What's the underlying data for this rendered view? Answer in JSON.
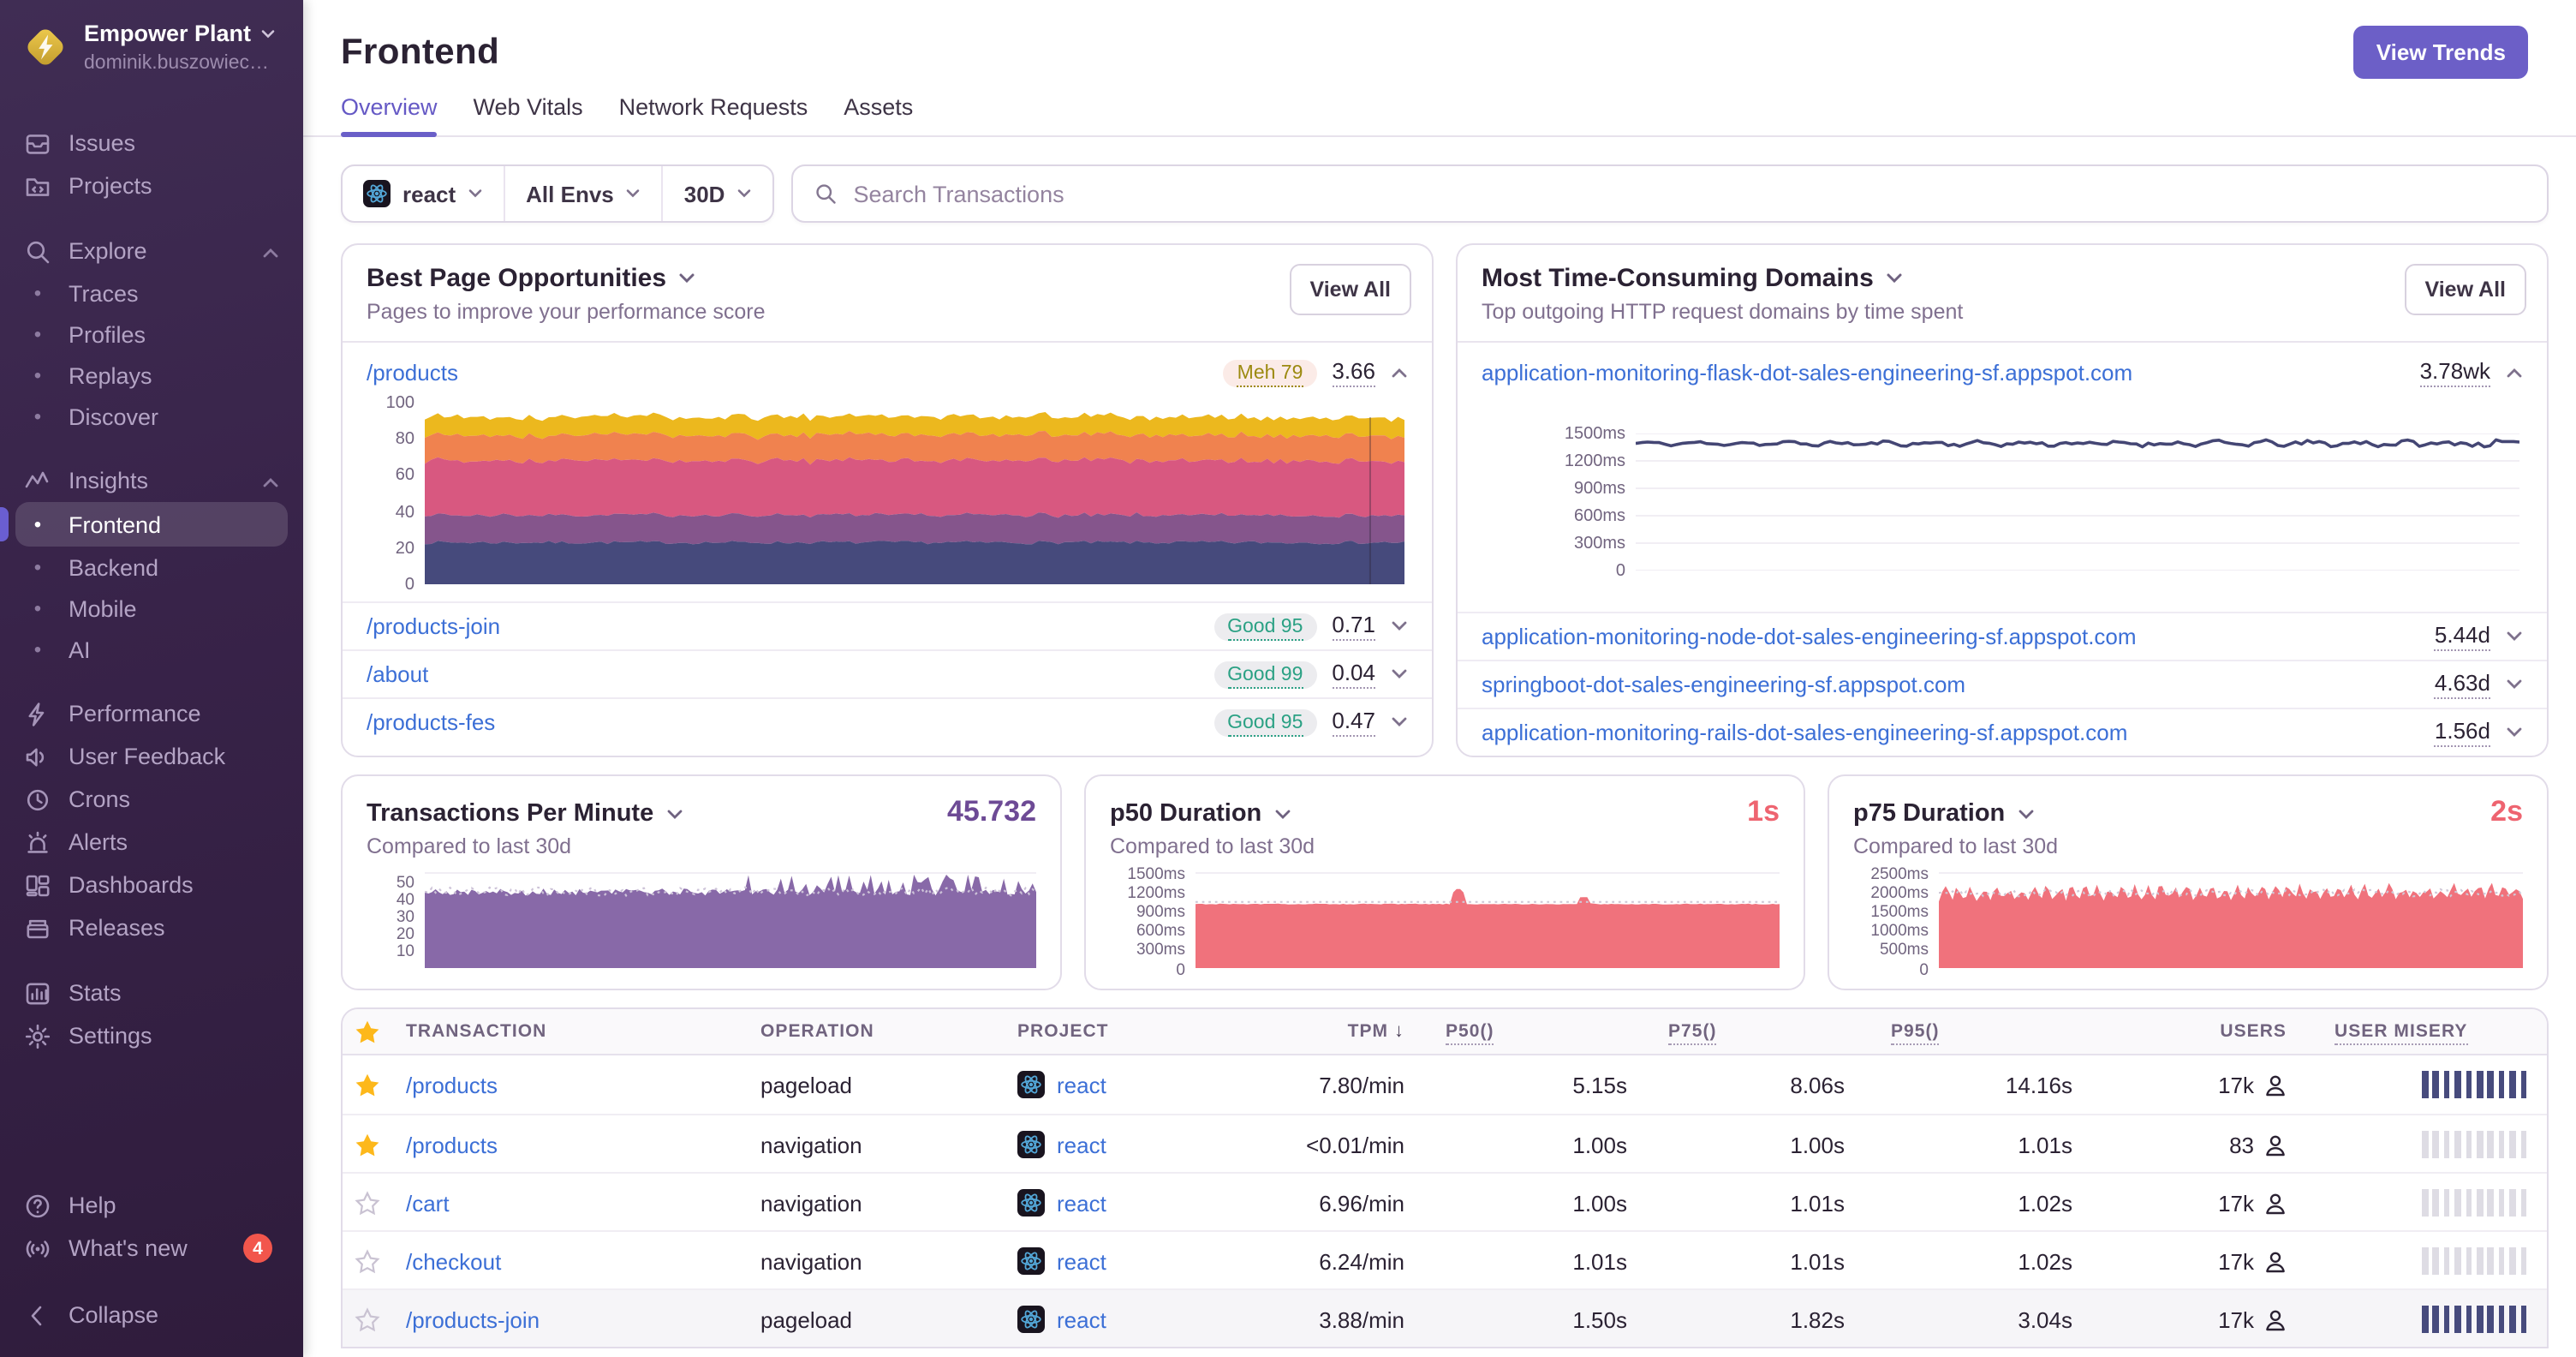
{
  "org": {
    "name": "Empower Plant",
    "subtitle": "dominik.buszowiec…"
  },
  "sidebar": {
    "groups": [
      {
        "items": [
          {
            "icon": "issues",
            "label": "Issues"
          },
          {
            "icon": "projects",
            "label": "Projects"
          }
        ]
      },
      {
        "header": {
          "icon": "search",
          "label": "Explore"
        },
        "items": [
          {
            "bullet": true,
            "label": "Traces"
          },
          {
            "bullet": true,
            "label": "Profiles"
          },
          {
            "bullet": true,
            "label": "Replays"
          },
          {
            "bullet": true,
            "label": "Discover"
          }
        ]
      },
      {
        "header": {
          "icon": "insights",
          "label": "Insights"
        },
        "items": [
          {
            "bullet": true,
            "label": "Frontend",
            "selected": true
          },
          {
            "bullet": true,
            "label": "Backend"
          },
          {
            "bullet": true,
            "label": "Mobile"
          },
          {
            "bullet": true,
            "label": "AI"
          }
        ]
      },
      {
        "items": [
          {
            "icon": "performance",
            "label": "Performance"
          },
          {
            "icon": "feedback",
            "label": "User Feedback"
          },
          {
            "icon": "crons",
            "label": "Crons"
          },
          {
            "icon": "alerts",
            "label": "Alerts"
          },
          {
            "icon": "dashboards",
            "label": "Dashboards"
          },
          {
            "icon": "releases",
            "label": "Releases"
          }
        ]
      },
      {
        "items": [
          {
            "icon": "stats",
            "label": "Stats"
          },
          {
            "icon": "settings",
            "label": "Settings"
          }
        ]
      }
    ],
    "footer": [
      {
        "icon": "help",
        "label": "Help"
      },
      {
        "icon": "broadcast",
        "label": "What's new",
        "badge": "4"
      },
      {
        "icon": "collapse",
        "label": "Collapse"
      }
    ]
  },
  "header": {
    "title": "Frontend",
    "view_trends": "View Trends",
    "tabs": [
      {
        "label": "Overview",
        "active": true
      },
      {
        "label": "Web Vitals"
      },
      {
        "label": "Network Requests"
      },
      {
        "label": "Assets"
      }
    ]
  },
  "filters": {
    "project": "react",
    "envs": "All Envs",
    "period": "30D",
    "search_placeholder": "Search Transactions"
  },
  "cards": {
    "best_pages": {
      "title": "Best Page Opportunities",
      "subtitle": "Pages to improve your performance score",
      "view_all": "View All",
      "rows": [
        {
          "path": "/products",
          "badge": {
            "label": "Meh",
            "score": "79",
            "tone": "meh"
          },
          "value": "3.66",
          "expanded": true
        },
        {
          "path": "/products-join",
          "badge": {
            "label": "Good",
            "score": "95",
            "tone": "good"
          },
          "value": "0.71"
        },
        {
          "path": "/about",
          "badge": {
            "label": "Good",
            "score": "99",
            "tone": "good"
          },
          "value": "0.04"
        },
        {
          "path": "/products-fes",
          "badge": {
            "label": "Good",
            "score": "95",
            "tone": "good"
          },
          "value": "0.47"
        }
      ],
      "chart": {
        "type": "stacked-area",
        "yticks": [
          100,
          80,
          60,
          40,
          20,
          0
        ],
        "ymax": 100,
        "layers": [
          {
            "color": "#464a7c",
            "value": 23
          },
          {
            "color": "#85558c",
            "value": 15
          },
          {
            "color": "#d85880",
            "value": 30
          },
          {
            "color": "#f0824f",
            "value": 14
          },
          {
            "color": "#ecb81e",
            "value": 10
          }
        ]
      }
    },
    "domains": {
      "title": "Most Time-Consuming Domains",
      "subtitle": "Top outgoing HTTP request domains by time spent",
      "view_all": "View All",
      "rows": [
        {
          "domain": "application-monitoring-flask-dot-sales-engineering-sf.appspot.com",
          "value": "3.78wk",
          "expanded": true
        },
        {
          "domain": "application-monitoring-node-dot-sales-engineering-sf.appspot.com",
          "value": "5.44d"
        },
        {
          "domain": "springboot-dot-sales-engineering-sf.appspot.com",
          "value": "4.63d"
        },
        {
          "domain": "application-monitoring-rails-dot-sales-engineering-sf.appspot.com",
          "value": "1.56d"
        }
      ],
      "chart": {
        "type": "line",
        "yticks": [
          "1500ms",
          "1200ms",
          "900ms",
          "600ms",
          "300ms",
          "0"
        ],
        "ymax": 1500,
        "baseline": 1390,
        "amplitude": 45,
        "color": "#444674"
      }
    }
  },
  "stat_cards": [
    {
      "title": "Transactions Per Minute",
      "subtitle": "Compared to last 30d",
      "value": "45.732",
      "accent": "#6d4a95",
      "chart": {
        "kind": "tpm",
        "yticks": [
          50,
          40,
          30,
          20,
          10
        ],
        "ymax": 55,
        "color": "#7b599f",
        "prev_color": "#cdc3d8"
      }
    },
    {
      "title": "p50 Duration",
      "subtitle": "Compared to last 30d",
      "value": "1s",
      "accent": "#ee6470",
      "chart": {
        "kind": "p50",
        "yticks": [
          "1500ms",
          "1200ms",
          "900ms",
          "600ms",
          "300ms",
          "0"
        ],
        "tickvals": [
          1500,
          1200,
          900,
          600,
          300,
          0
        ],
        "ymax": 1500,
        "baseline": 1000,
        "spikes": [
          [
            0.45,
            1235
          ],
          [
            0.665,
            1110
          ]
        ],
        "color": "#ef6a75",
        "prev_color": "#cfc8d6"
      }
    },
    {
      "title": "p75 Duration",
      "subtitle": "Compared to last 30d",
      "value": "2s",
      "accent": "#ee6470",
      "chart": {
        "kind": "p75",
        "yticks": [
          "2500ms",
          "2000ms",
          "1500ms",
          "1000ms",
          "500ms",
          "0"
        ],
        "tickvals": [
          2500,
          2000,
          1500,
          1000,
          500,
          0
        ],
        "ymax": 2500,
        "color": "#ef6a75",
        "prev_color": "#cfc8d6"
      }
    }
  ],
  "table": {
    "columns": [
      {
        "label": "TRANSACTION"
      },
      {
        "label": "OPERATION"
      },
      {
        "label": "PROJECT"
      },
      {
        "label": "TPM",
        "sorted": "desc",
        "align": "right"
      },
      {
        "label": "P50()",
        "dotted": true
      },
      {
        "label": "P75()",
        "dotted": true
      },
      {
        "label": "P95()",
        "dotted": true
      },
      {
        "label": "USERS",
        "align": "right"
      },
      {
        "label": "USER MISERY",
        "dotted": true
      }
    ],
    "rows": [
      {
        "fav": true,
        "transaction": "/products",
        "operation": "pageload",
        "project": "react",
        "tpm": "7.80/min",
        "p50": "5.15s",
        "p75": "8.06s",
        "p95": "14.16s",
        "users": "17k",
        "misery": "high"
      },
      {
        "fav": true,
        "transaction": "/products",
        "operation": "navigation",
        "project": "react",
        "tpm": "<0.01/min",
        "p50": "1.00s",
        "p75": "1.00s",
        "p95": "1.01s",
        "users": "83",
        "misery": "low"
      },
      {
        "fav": false,
        "transaction": "/cart",
        "operation": "navigation",
        "project": "react",
        "tpm": "6.96/min",
        "p50": "1.00s",
        "p75": "1.01s",
        "p95": "1.02s",
        "users": "17k",
        "misery": "low"
      },
      {
        "fav": false,
        "transaction": "/checkout",
        "operation": "navigation",
        "project": "react",
        "tpm": "6.24/min",
        "p50": "1.01s",
        "p75": "1.01s",
        "p95": "1.02s",
        "users": "17k",
        "misery": "low"
      },
      {
        "fav": false,
        "transaction": "/products-join",
        "operation": "pageload",
        "project": "react",
        "tpm": "3.88/min",
        "p50": "1.50s",
        "p75": "1.82s",
        "p95": "3.04s",
        "users": "17k",
        "misery": "high",
        "hover": true
      }
    ]
  }
}
